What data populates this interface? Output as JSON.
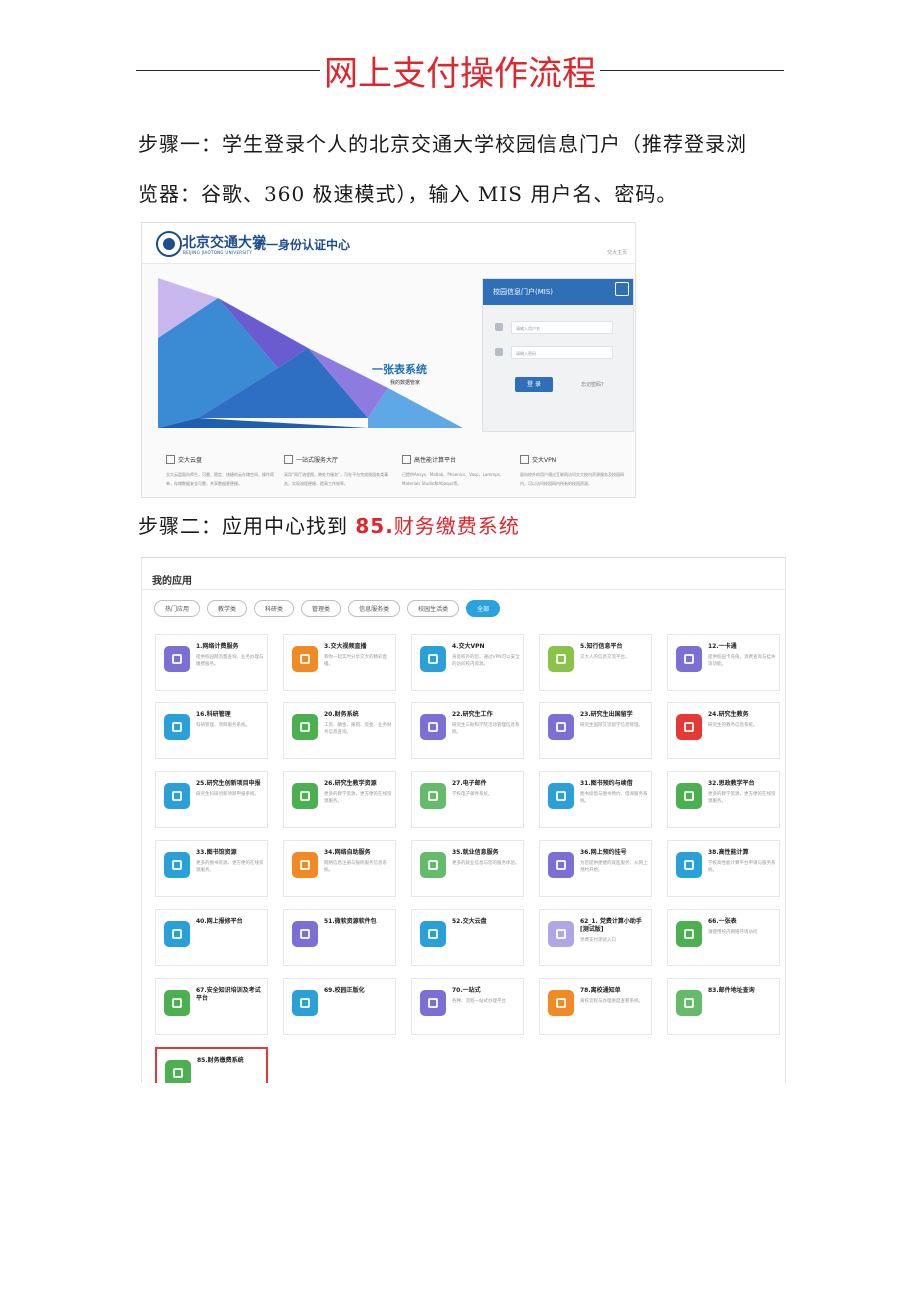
{
  "title": "网上支付操作流程",
  "step1": {
    "line1": "步骤一：学生登录个人的北京交通大学校园信息门户（推荐登录浏",
    "line2": "览器：谷歌、360 极速模式），输入 MIS 用户名、密码。"
  },
  "step2": {
    "prefix": "步骤二：应用中心找到 ",
    "num": "85.",
    "target": "财务缴费系统"
  },
  "login": {
    "logo": "北京交通大学",
    "logo_sub": "BEIJING JIAOTONG UNIVERSITY",
    "center": "统一身份认证中心",
    "home": "交大主页",
    "banner_title": "一张表系统",
    "banner_sub": "我的数据管家",
    "box_title": "校园信息门户(MIS)",
    "user_placeholder": "请输入用户名",
    "pass_placeholder": "请输入密码",
    "login_btn": "登 录",
    "forgot": "忘记密码？",
    "services": [
      {
        "name": "交大云盘",
        "desc": "交大云盘面向师生，可靠、稳定、快捷的云存储空间，操作简单，存储数据安全可靠，共享数据更便捷。"
      },
      {
        "name": "一站式服务大厅",
        "desc": "采用“网厅流程图，跨处力服务”，可在平台完成校园各类事务，实现流程便捷，提高工作效率。"
      },
      {
        "name": "高性能计算平台",
        "desc": "已提供Ansys、Matlab、Phoenics、Vasp、Lammps、Materials Studio和Abaqus等。"
      },
      {
        "name": "交大VPN",
        "desc": "面向校外的用户通过互联网访问交大校内资源服务及校园网内，可以访问校园网内所有的校园资源。"
      }
    ]
  },
  "apps": {
    "header": "我的应用",
    "filters": [
      "热门应用",
      "教学类",
      "科研类",
      "管理类",
      "信息服务类",
      "校园生活类",
      "全部"
    ],
    "items": [
      {
        "name": "1.网络计费服务",
        "desc": "提供校园网流量查询、业务办理与缴费服务。",
        "color": "#7b6fd6"
      },
      {
        "name": "3.交大视频直播",
        "desc": "和你一起实时分享交大的精彩直播。",
        "color": "#f08a24"
      },
      {
        "name": "4.交大VPN",
        "desc": "身处校外的您，通过VPN可以安全的访问校内资源。",
        "color": "#2a9fd8"
      },
      {
        "name": "5.知行信息平台",
        "desc": "交大人的信息交流平台。",
        "color": "#8bc34a"
      },
      {
        "name": "12.一卡通",
        "desc": "提供校园卡充值、消费查询与挂失等功能。",
        "color": "#7b6fd6"
      },
      {
        "name": "16.科研管理",
        "desc": "科研管理、项目服务系统。",
        "color": "#2a9fd8"
      },
      {
        "name": "20.财务系统",
        "desc": "工资、酬金、报销、资金、业务财务信息查询。",
        "color": "#4caf50"
      },
      {
        "name": "22.研究生工作",
        "desc": "研究生三助和学院活动管理信息系统。",
        "color": "#7b6fd6"
      },
      {
        "name": "23.研究生出国留学",
        "desc": "研究生国际交流留学信息管理。",
        "color": "#7b6fd6"
      },
      {
        "name": "24.研究生教务",
        "desc": "研究生的教务信息系统。",
        "color": "#e53935"
      },
      {
        "name": "25.研究生创新项目申报",
        "desc": "研究生科研创新项目申报系统。",
        "color": "#2a9fd8"
      },
      {
        "name": "26.研究生教学资源",
        "desc": "更多的教学资源，更方便的在线资源服务。",
        "color": "#4caf50"
      },
      {
        "name": "27.电子邮件",
        "desc": "学校电子邮件系统。",
        "color": "#66bb6a"
      },
      {
        "name": "31.图书预约与续借",
        "desc": "图书续借与图书预约、借阅服务系统。",
        "color": "#2a9fd8"
      },
      {
        "name": "32.思政教学平台",
        "desc": "更多的教学资源，更方便的在线资源服务。",
        "color": "#4caf50"
      },
      {
        "name": "33.图书馆资源",
        "desc": "更多的图书资源，更方便的在线资源服务。",
        "color": "#2a9fd8"
      },
      {
        "name": "34.网络自助服务",
        "desc": "网络信息注册与报修服务信息系统。",
        "color": "#f08a24"
      },
      {
        "name": "35.就业信息服务",
        "desc": "更多的就业信息与您的服务体验。",
        "color": "#66bb6a"
      },
      {
        "name": "36.网上预约挂号",
        "desc": "为您提供便捷的就医服务，从网上预约开始。",
        "color": "#7b6fd6"
      },
      {
        "name": "38.高性能计算",
        "desc": "学校高性能计算平台申请与服务系统。",
        "color": "#2a9fd8"
      },
      {
        "name": "40.网上报修平台",
        "desc": "",
        "color": "#2a9fd8"
      },
      {
        "name": "51.微软资源软件包",
        "desc": "",
        "color": "#7b6fd6"
      },
      {
        "name": "52.交大云盘",
        "desc": "",
        "color": "#2a9fd8"
      },
      {
        "name": "62_1. 党费计算小助手[测试版]",
        "desc": "党费支付测试入口",
        "color": "#b0a6e6"
      },
      {
        "name": "66.一张表",
        "desc": "请使用校内网络环境访问",
        "color": "#4caf50"
      },
      {
        "name": "67.安全知识培训及考试平台",
        "desc": "",
        "color": "#4caf50"
      },
      {
        "name": "69.校园正版化",
        "desc": "",
        "color": "#2a9fd8"
      },
      {
        "name": "70.一站式",
        "desc": "各种、流程一站式办理平台",
        "color": "#7b6fd6"
      },
      {
        "name": "78.离校通知单",
        "desc": "离校流程与办理进度查看系统。",
        "color": "#f08a24"
      },
      {
        "name": "83.邮件地址查询",
        "desc": "",
        "color": "#66bb6a"
      },
      {
        "name": "85.财务缴费系统",
        "desc": "",
        "color": "#4caf50"
      }
    ]
  }
}
